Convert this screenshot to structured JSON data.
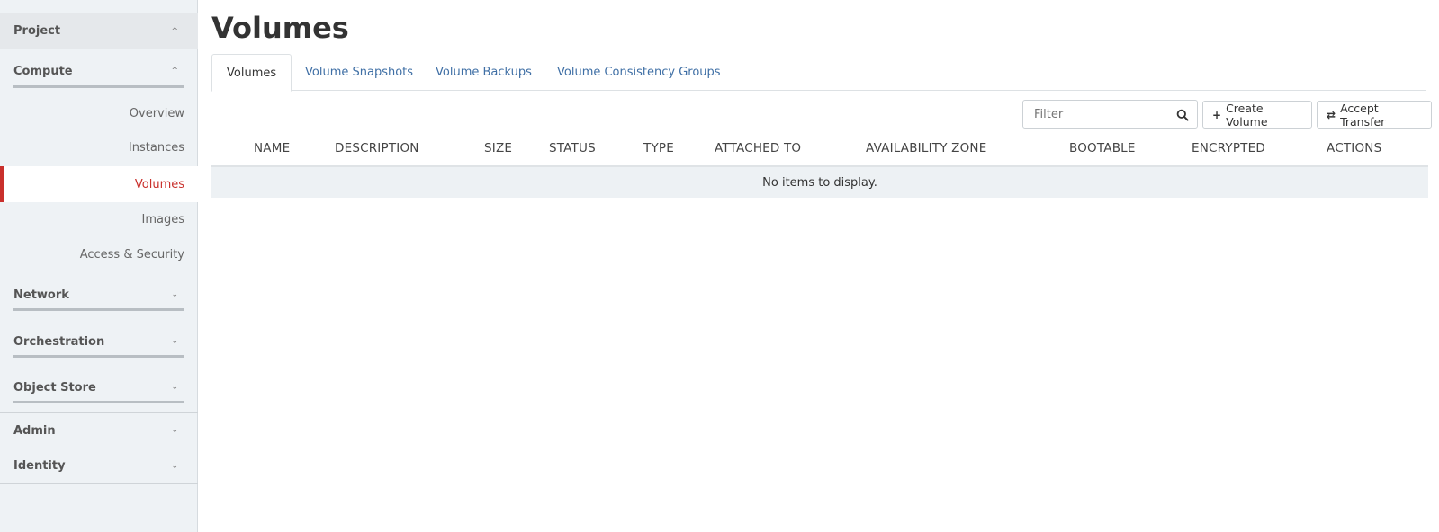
{
  "sidebar": {
    "project": "Project",
    "compute": "Compute",
    "links": {
      "overview": "Overview",
      "instances": "Instances",
      "volumes": "Volumes",
      "images": "Images",
      "access": "Access & Security"
    },
    "network": "Network",
    "orchestration": "Orchestration",
    "object_store": "Object Store",
    "admin": "Admin",
    "identity": "Identity",
    "chevron_up": "^",
    "chevron_down": "⌄"
  },
  "page": {
    "title": "Volumes"
  },
  "tabs": [
    {
      "label": "Volumes",
      "active": true
    },
    {
      "label": "Volume Snapshots"
    },
    {
      "label": "Volume Backups"
    },
    {
      "label": "Volume Consistency Groups"
    }
  ],
  "toolbar": {
    "filter_placeholder": "Filter",
    "create_icon": "+",
    "create_label": "Create Volume",
    "accept_icon": "⇄",
    "accept_label": "Accept Transfer"
  },
  "table": {
    "columns": [
      "NAME",
      "DESCRIPTION",
      "SIZE",
      "STATUS",
      "TYPE",
      "ATTACHED TO",
      "AVAILABILITY ZONE",
      "BOOTABLE",
      "ENCRYPTED",
      "ACTIONS"
    ],
    "empty_text": "No items to display."
  },
  "colors": {
    "accent_active": "#c9302c",
    "link": "#3f6fa5",
    "sidebar_bg": "#eef2f5"
  }
}
